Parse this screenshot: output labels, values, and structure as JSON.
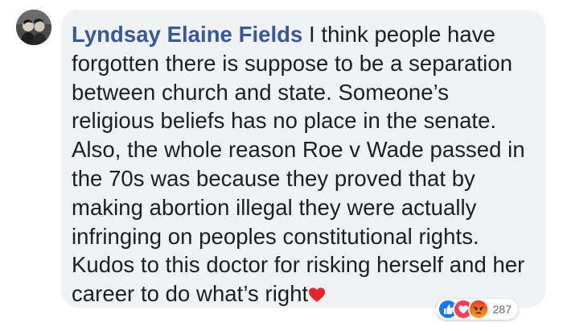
{
  "comment": {
    "author": "Lyndsay Elaine Fields",
    "lines": [
      " I think people have",
      "forgotten there is suppose to be a separation",
      "between church and state. Someone’s",
      "religious beliefs has no place in the senate.",
      "Also, the whole reason Roe v Wade passed in",
      "the 70s was because they proved that by",
      "making abortion illegal they were actually",
      "infringing on peoples constitutional rights.",
      "Kudos to this doctor for risking herself and her",
      "career to do what’s right"
    ],
    "trailing_emoji": "heart-icon"
  },
  "reactions": {
    "icons": [
      "like-icon",
      "love-icon",
      "angry-icon"
    ],
    "count": "287"
  },
  "colors": {
    "author": "#385898",
    "bubble": "#f0f2f5",
    "text": "#1c1e21",
    "like": "#1877f2",
    "love": "#f33e58",
    "angry": "#e9710f"
  }
}
